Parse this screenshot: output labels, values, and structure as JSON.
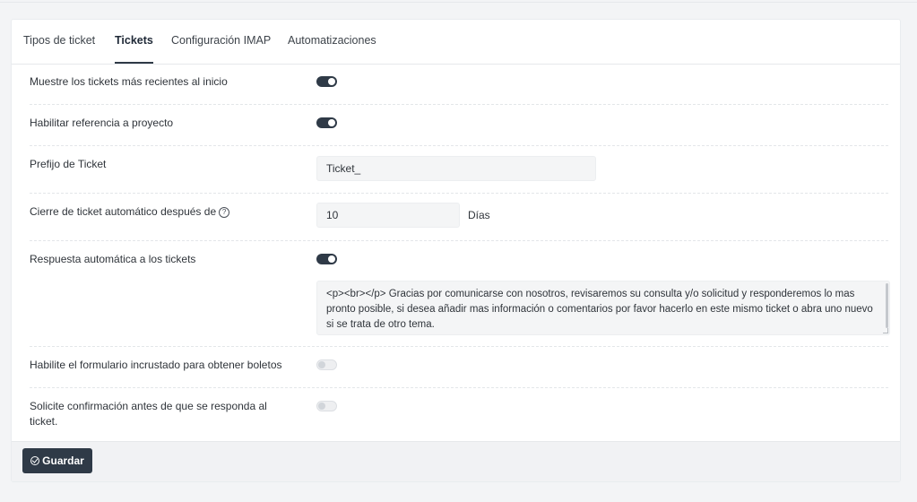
{
  "tabs": [
    {
      "label": "Tipos de ticket",
      "active": false
    },
    {
      "label": "Tickets",
      "active": true
    },
    {
      "label": "Configuración IMAP",
      "active": false
    },
    {
      "label": "Automatizaciones",
      "active": false
    }
  ],
  "settings": {
    "recent_first": {
      "label": "Muestre los tickets más recientes al inicio",
      "enabled": true
    },
    "project_reference": {
      "label": "Habilitar referencia a proyecto",
      "enabled": true
    },
    "ticket_prefix": {
      "label": "Prefijo de Ticket",
      "value": "Ticket_"
    },
    "auto_close": {
      "label": "Cierre de ticket automático después de",
      "value": "10",
      "unit": "Días",
      "help_icon": "question-circle-icon"
    },
    "auto_reply": {
      "label": "Respuesta automática a los tickets",
      "enabled": true,
      "message": "<p><br></p> Gracias por comunicarse con nosotros, revisaremos su consulta y/o solicitud y responderemos lo mas pronto posible, si desea añadir mas información o comentarios por favor hacerlo en este mismo ticket o abra uno nuevo si se trata de otro tema."
    },
    "embedded_form": {
      "label": "Habilite el formulario incrustado para obtener boletos",
      "enabled": false
    },
    "confirm_before_reply": {
      "label": "Solicite confirmación antes de que se responda al ticket.",
      "enabled": false
    }
  },
  "footer": {
    "save_label": "Guardar",
    "save_icon": "check-circle-icon"
  },
  "colors": {
    "accent": "#2f3a47",
    "background": "#f3f4f6"
  }
}
